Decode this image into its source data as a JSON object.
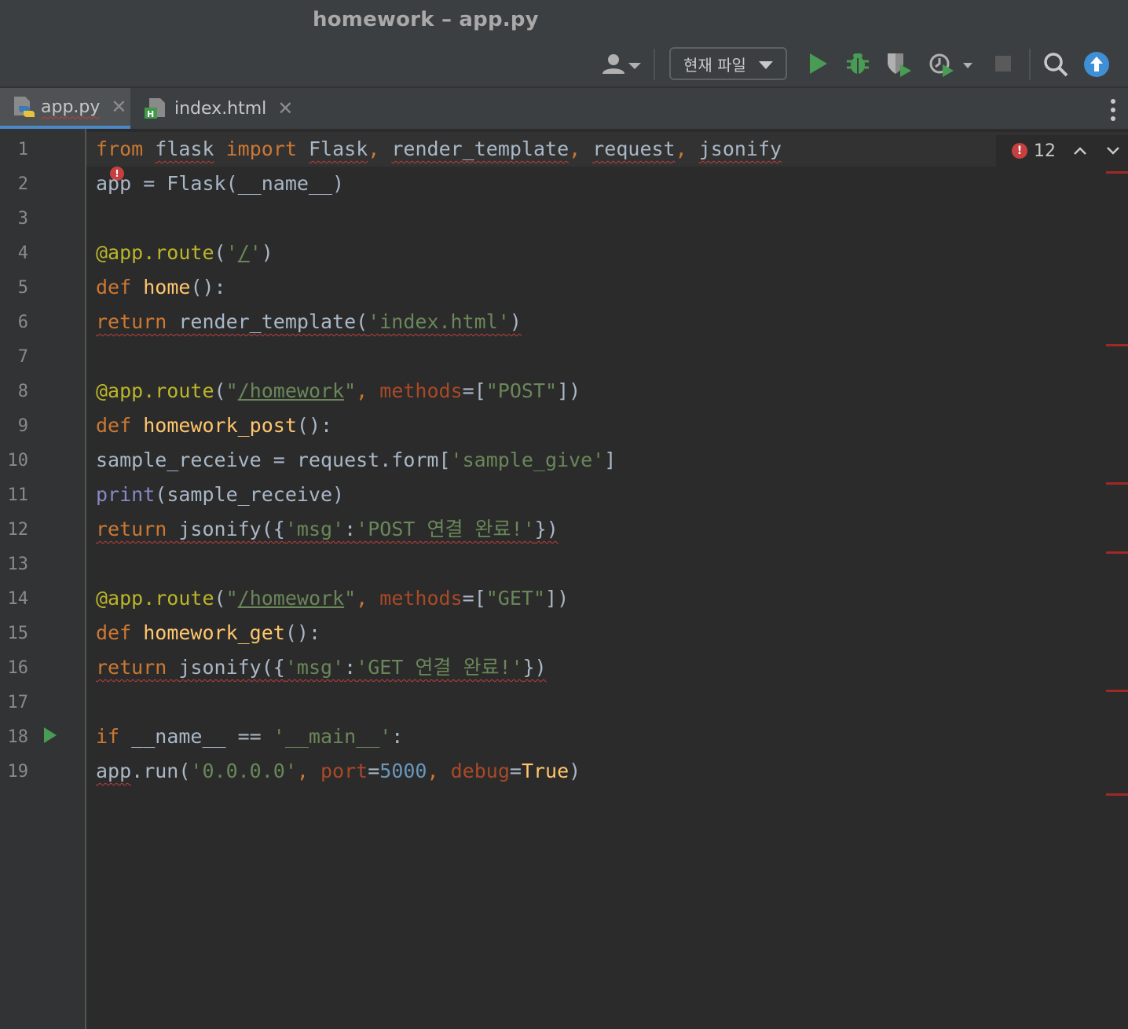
{
  "window": {
    "title": "homework – app.py"
  },
  "toolbar": {
    "run_config": "현재 파일",
    "icons": [
      "user-icon",
      "run-icon",
      "debug-icon",
      "coverage-icon",
      "profile-icon",
      "stop-icon",
      "search-icon",
      "update-icon"
    ]
  },
  "tabs": [
    {
      "label": "app.py",
      "active": true
    },
    {
      "label": "index.html",
      "active": false
    }
  ],
  "inspections": {
    "error_count": "12"
  },
  "line_numbers": [
    "1",
    "2",
    "3",
    "4",
    "5",
    "6",
    "7",
    "8",
    "9",
    "10",
    "11",
    "12",
    "13",
    "14",
    "15",
    "16",
    "17",
    "18",
    "19"
  ],
  "code": {
    "l1": [
      "from",
      " ",
      "flask",
      " ",
      "import",
      " ",
      "Flask",
      ", ",
      "render_template",
      ", ",
      "request",
      ", ",
      "jsonify"
    ],
    "l2": [
      "app",
      " = Flask(__name__)"
    ],
    "l4": [
      "@app.route",
      "(",
      "'",
      "/",
      "'",
      ")"
    ],
    "l5": [
      "def",
      " ",
      "home",
      "():"
    ],
    "l6": [
      "return",
      " ",
      "render_template(",
      "'index.html'",
      ")"
    ],
    "l8": [
      "@app.route",
      "(",
      "\"",
      "/homework",
      "\"",
      ", ",
      "methods",
      "=[",
      "\"POST\"",
      "])"
    ],
    "l9": [
      "def",
      " ",
      "homework_post",
      "():"
    ],
    "l10": [
      "sample_receive",
      " = request.form[",
      "'sample_give'",
      "]"
    ],
    "l11": [
      "print",
      "(sample_receive)"
    ],
    "l12": [
      "return",
      " ",
      "jsonify({",
      "'msg'",
      ":",
      "'POST 연결 완료!'",
      "})"
    ],
    "l14": [
      "@app.route",
      "(",
      "\"",
      "/homework",
      "\"",
      ", ",
      "methods",
      "=[",
      "\"GET\"",
      "])"
    ],
    "l15": [
      "def",
      " ",
      "homework_get",
      "():"
    ],
    "l16": [
      "return",
      " ",
      "jsonify({",
      "'msg'",
      ":",
      "'GET 연결 완료!'",
      "})"
    ],
    "l18": [
      "if",
      " __name__ == ",
      "'__main__'",
      ":"
    ],
    "l19": [
      "app",
      ".run(",
      "'0.0.0.0'",
      ", ",
      "port",
      "=",
      "5000",
      ", ",
      "debug",
      "=",
      "True",
      ")"
    ]
  },
  "colors": {
    "keyword": "#cc7832",
    "function": "#ffc66d",
    "string": "#6a8759",
    "decorator": "#bbb529",
    "number": "#6897bb",
    "param": "#aa4926",
    "builtin": "#8888c6",
    "error": "#bc3f3c",
    "run_green": "#499c54",
    "accent": "#4a88c7"
  }
}
